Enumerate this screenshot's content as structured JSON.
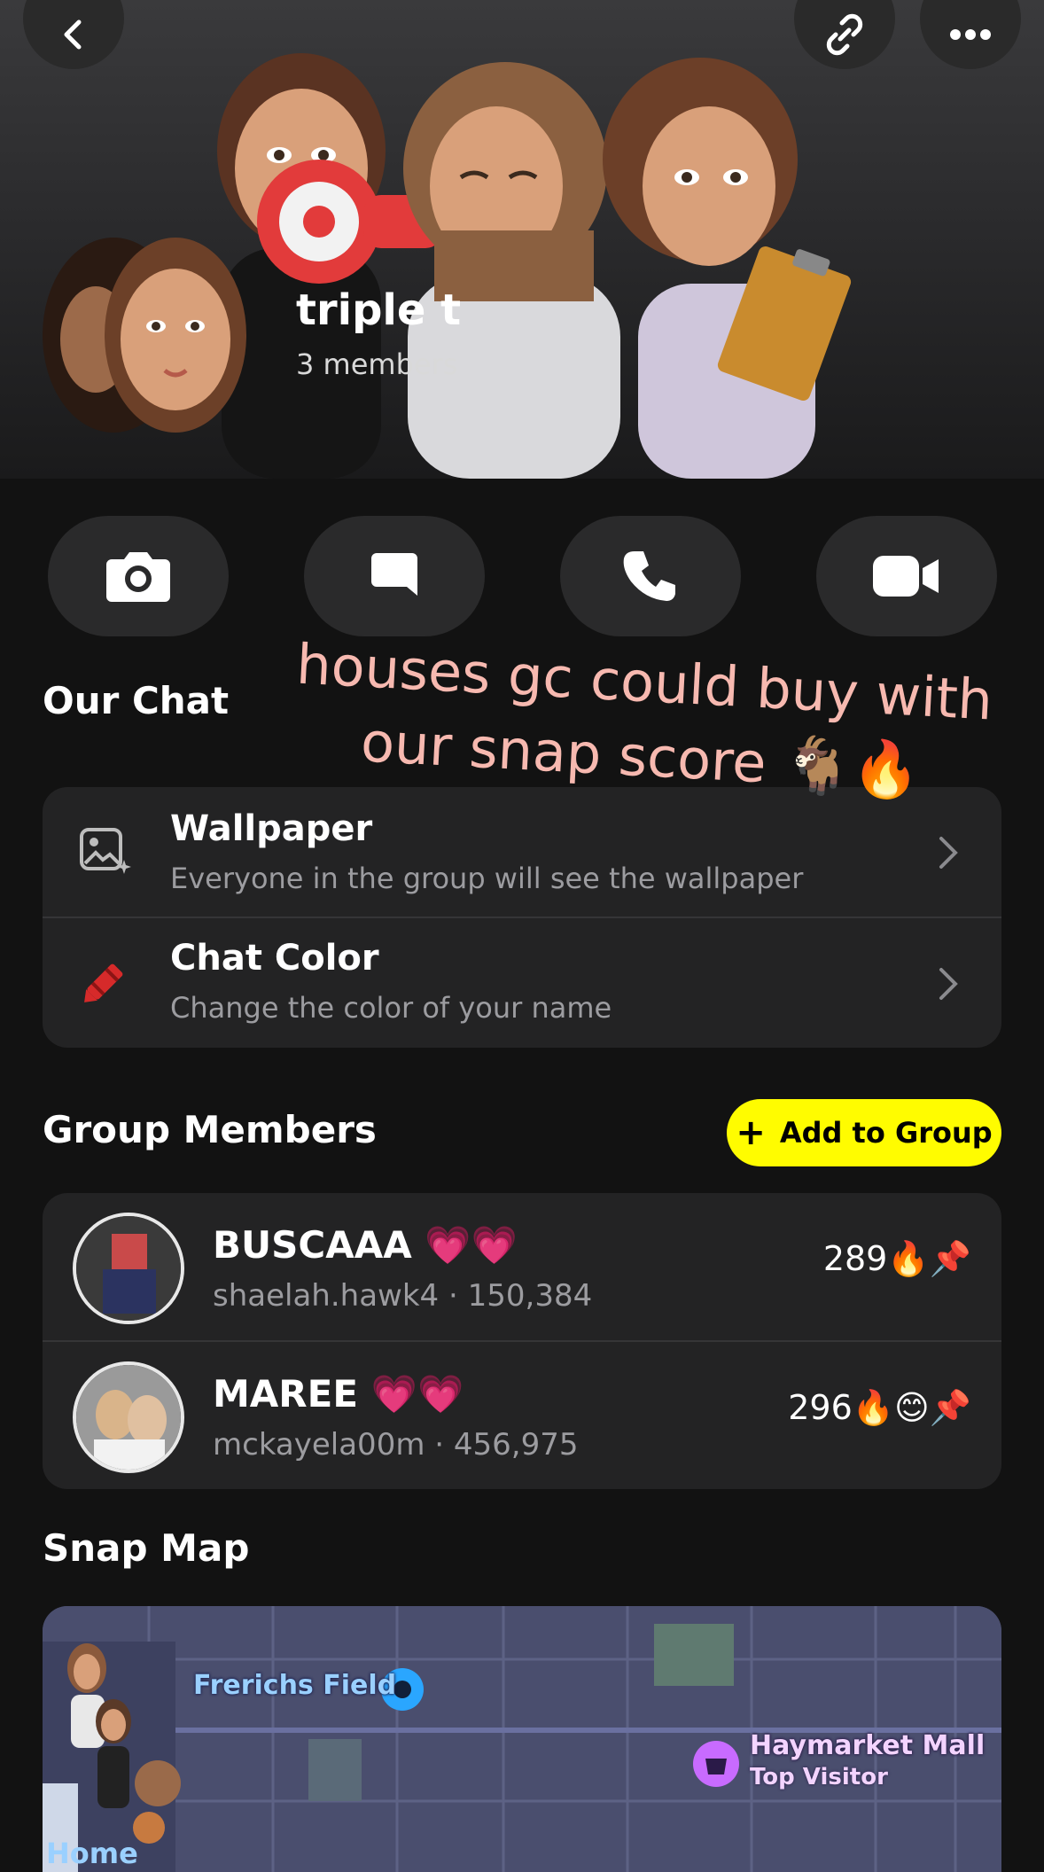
{
  "header": {
    "group_name": "triple t",
    "member_count": "3 members"
  },
  "actions": [
    {
      "icon": "camera-icon"
    },
    {
      "icon": "chat-icon"
    },
    {
      "icon": "phone-icon"
    },
    {
      "icon": "video-icon"
    }
  ],
  "our_chat": {
    "title": "Our Chat",
    "items": [
      {
        "title": "Wallpaper",
        "subtitle": "Everyone in the group will see the wallpaper",
        "icon": "wallpaper-icon"
      },
      {
        "title": "Chat Color",
        "subtitle": "Change the color of your name",
        "icon": "crayon-icon"
      }
    ]
  },
  "caption": {
    "line1": "houses gc could buy with",
    "line2": "our snap score 🐐🔥"
  },
  "group_members": {
    "title": "Group Members",
    "add_button_label": "Add to Group",
    "members": [
      {
        "name": "BUSCAAA 💗💗",
        "username": "shaelah.hawk4",
        "score": "150,384",
        "streak": "289🔥📌"
      },
      {
        "name": "MAREE 💗💗",
        "username": "mckayela00m",
        "score": "456,975",
        "streak": "296🔥😊📌"
      }
    ]
  },
  "snap_map": {
    "title": "Snap Map",
    "places": [
      {
        "label": "Frerichs Field"
      },
      {
        "label": "Haymarket Mall",
        "sub": "Top Visitor"
      },
      {
        "label": "Home"
      }
    ]
  },
  "colors": {
    "accent_yellow": "#fffc00",
    "background": "#121212",
    "card": "#232324",
    "caption_pink": "#f7b9b0"
  }
}
